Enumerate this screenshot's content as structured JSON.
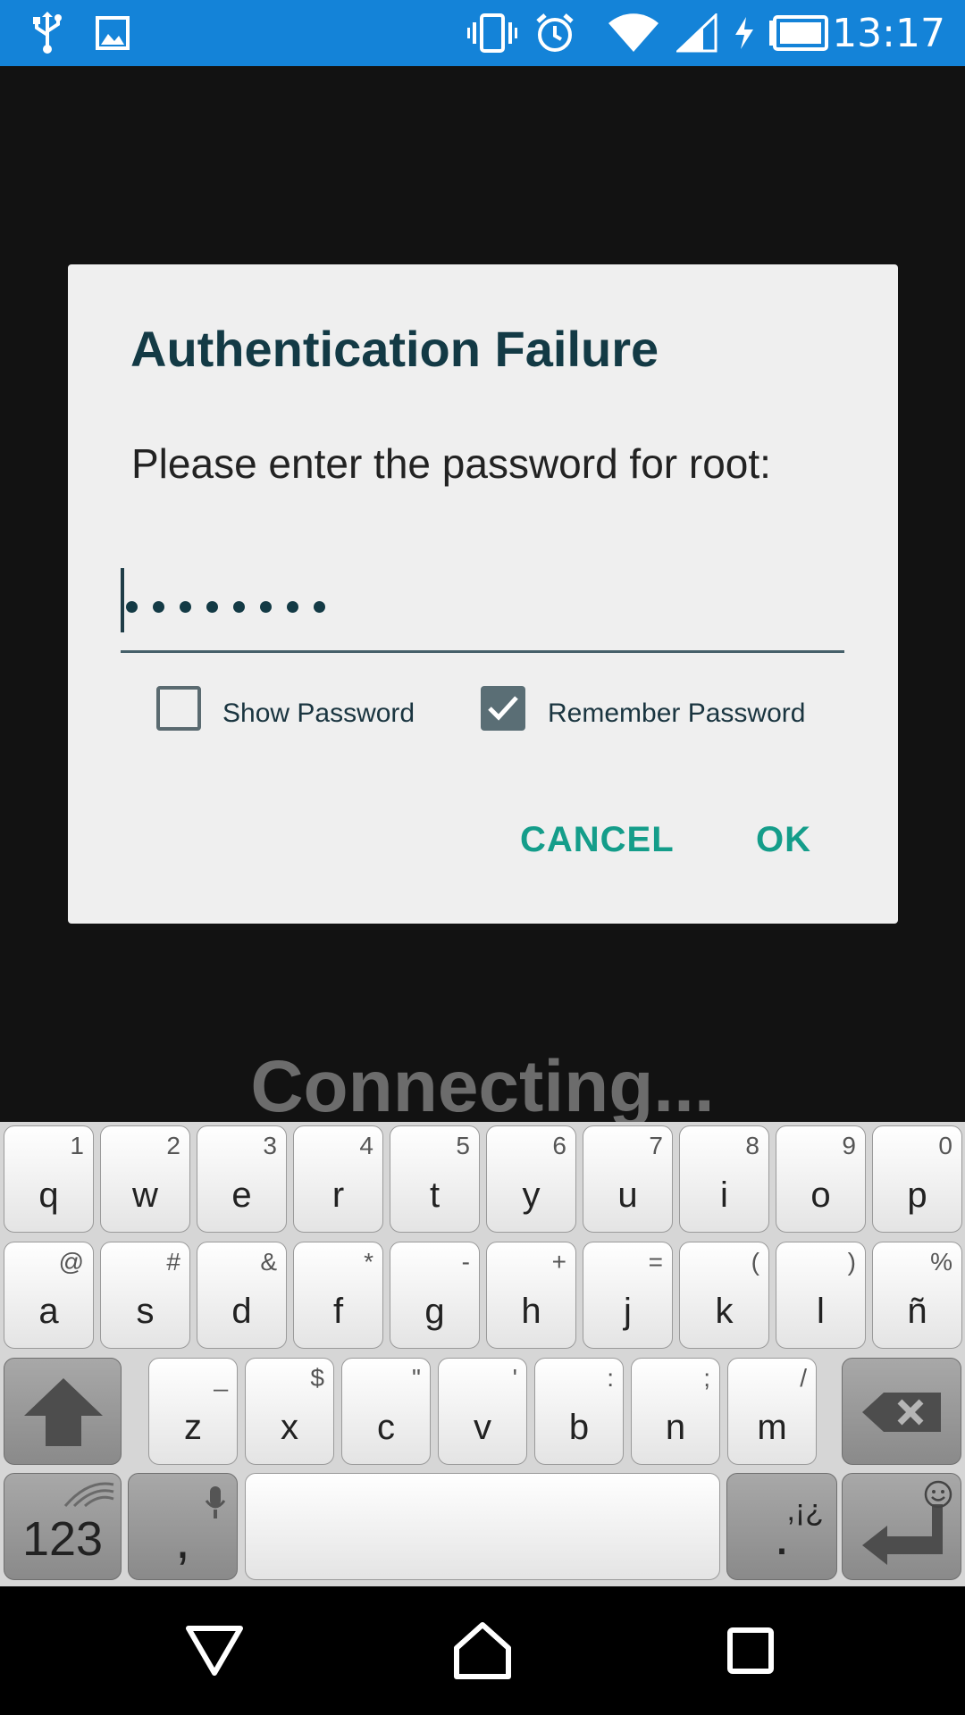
{
  "status_bar": {
    "time": "13:17",
    "icons": [
      "usb-icon",
      "image-icon",
      "vibrate-icon",
      "alarm-icon",
      "wifi-icon",
      "signal-icon",
      "battery-charging-icon"
    ]
  },
  "background": {
    "status_text": "Connecting..."
  },
  "dialog": {
    "title": "Authentication Failure",
    "message": "Please enter the password for root:",
    "password_masked": "••••••••",
    "show_password_label": "Show Password",
    "show_password_checked": false,
    "remember_password_label": "Remember Password",
    "remember_password_checked": true,
    "cancel_label": "CANCEL",
    "ok_label": "OK",
    "accent_color": "#149d8a"
  },
  "keyboard": {
    "row1": [
      {
        "main": "q",
        "sub": "1"
      },
      {
        "main": "w",
        "sub": "2"
      },
      {
        "main": "e",
        "sub": "3"
      },
      {
        "main": "r",
        "sub": "4"
      },
      {
        "main": "t",
        "sub": "5"
      },
      {
        "main": "y",
        "sub": "6"
      },
      {
        "main": "u",
        "sub": "7"
      },
      {
        "main": "i",
        "sub": "8"
      },
      {
        "main": "o",
        "sub": "9"
      },
      {
        "main": "p",
        "sub": "0"
      }
    ],
    "row2": [
      {
        "main": "a",
        "sub": "@"
      },
      {
        "main": "s",
        "sub": "#"
      },
      {
        "main": "d",
        "sub": "&"
      },
      {
        "main": "f",
        "sub": "*"
      },
      {
        "main": "g",
        "sub": "-"
      },
      {
        "main": "h",
        "sub": "+"
      },
      {
        "main": "j",
        "sub": "="
      },
      {
        "main": "k",
        "sub": "("
      },
      {
        "main": "l",
        "sub": ")"
      },
      {
        "main": "ñ",
        "sub": "%"
      }
    ],
    "row3": [
      {
        "main": "z",
        "sub": "_"
      },
      {
        "main": "x",
        "sub": "$"
      },
      {
        "main": "c",
        "sub": "\""
      },
      {
        "main": "v",
        "sub": "'"
      },
      {
        "main": "b",
        "sub": ":"
      },
      {
        "main": "n",
        "sub": ";"
      },
      {
        "main": "m",
        "sub": "/"
      }
    ],
    "numbers_key": "123",
    "comma_key": ",",
    "period_key": ".",
    "period_sub": ",¡¿"
  },
  "nav_bar": {
    "icons": [
      "back-icon",
      "home-icon",
      "recents-icon"
    ]
  }
}
